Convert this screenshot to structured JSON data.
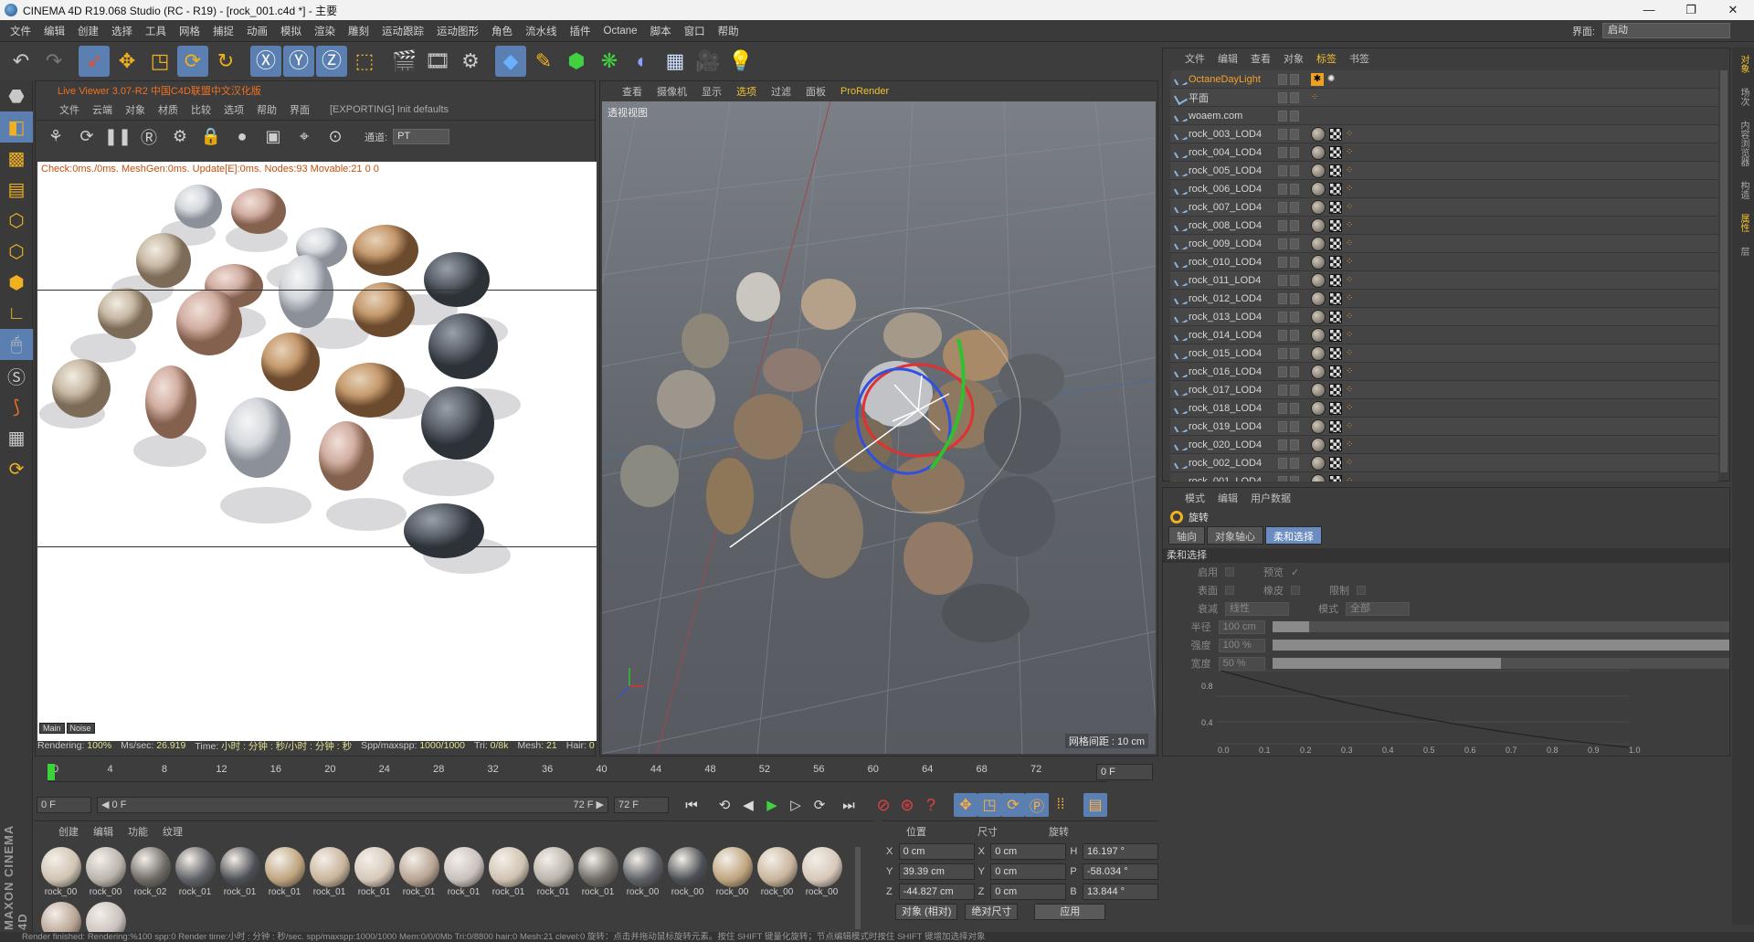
{
  "window": {
    "title": "CINEMA 4D R19.068 Studio (RC - R19) - [rock_001.c4d *] - 主要",
    "minimize": "—",
    "maximize": "❐",
    "close": "✕"
  },
  "menubar": {
    "items": [
      "文件",
      "编辑",
      "创建",
      "选择",
      "工具",
      "网格",
      "捕捉",
      "动画",
      "模拟",
      "渲染",
      "雕刻",
      "运动跟踪",
      "运动图形",
      "角色",
      "流水线",
      "插件",
      "Octane",
      "脚本",
      "窗口",
      "帮助"
    ],
    "layout_label": "界面:",
    "layout_value": "启动"
  },
  "toolbar": {
    "icons": [
      "undo-icon",
      "redo-icon",
      "select-icon",
      "move-icon",
      "scale-icon",
      "rotate-icon",
      "recent-icon",
      "x-axis-icon",
      "y-axis-icon",
      "z-axis-icon",
      "coord-system-icon",
      "render-view-icon",
      "render-picture-viewer-icon",
      "render-settings-icon",
      "cube-icon",
      "pen-icon",
      "subdivision-icon",
      "array-icon",
      "deformer-icon",
      "floor-icon",
      "camera-icon",
      "light-icon"
    ]
  },
  "live_viewer": {
    "title": "Live Viewer 3.07-R2 中国C4D联盟中文汉化版",
    "menu": [
      "文件",
      "云端",
      "对象",
      "材质",
      "比较",
      "选项",
      "帮助",
      "界面"
    ],
    "status": "[EXPORTING] Init defaults",
    "channel_label": "通道:",
    "channel_value": "PT",
    "info": "Check:0ms./0ms. MeshGen:0ms. Update[E]:0ms. Nodes:93 Movable:21  0 0",
    "tabs": [
      "Main",
      "Noise"
    ],
    "status_bar": {
      "rendering_label": "Rendering:",
      "rendering_value": "100%",
      "mssec_label": "Ms/sec:",
      "mssec_value": "26.919",
      "time_label": "Time:",
      "time_value": "小时 : 分钟 : 秒/小时 : 分钟 : 秒",
      "spp_label": "Spp/maxspp:",
      "spp_value": "1000/1000",
      "tri_label": "Tri:",
      "tri_value": "0/8k",
      "mesh_label": "Mesh:",
      "mesh_value": "21",
      "hair_label": "Hair:",
      "hair_value": "0"
    }
  },
  "viewport": {
    "menu": [
      "查看",
      "摄像机",
      "显示",
      "选项",
      "过滤",
      "面板",
      "ProRender"
    ],
    "label": "透视视图",
    "grid_label": "网格间距 : 10 cm"
  },
  "object_manager": {
    "menu": [
      "文件",
      "编辑",
      "查看",
      "对象",
      "标签",
      "书签"
    ],
    "objects": [
      {
        "name": "OctaneDayLight",
        "kind": "light"
      },
      {
        "name": "平面",
        "kind": "plane"
      },
      {
        "name": "woaem.com",
        "kind": "null"
      },
      {
        "name": "rock_003_LOD4",
        "kind": "rock"
      },
      {
        "name": "rock_004_LOD4",
        "kind": "rock"
      },
      {
        "name": "rock_005_LOD4",
        "kind": "rock"
      },
      {
        "name": "rock_006_LOD4",
        "kind": "rock"
      },
      {
        "name": "rock_007_LOD4",
        "kind": "rock"
      },
      {
        "name": "rock_008_LOD4",
        "kind": "rock"
      },
      {
        "name": "rock_009_LOD4",
        "kind": "rock"
      },
      {
        "name": "rock_010_LOD4",
        "kind": "rock"
      },
      {
        "name": "rock_011_LOD4",
        "kind": "rock"
      },
      {
        "name": "rock_012_LOD4",
        "kind": "rock"
      },
      {
        "name": "rock_013_LOD4",
        "kind": "rock"
      },
      {
        "name": "rock_014_LOD4",
        "kind": "rock"
      },
      {
        "name": "rock_015_LOD4",
        "kind": "rock"
      },
      {
        "name": "rock_016_LOD4",
        "kind": "rock"
      },
      {
        "name": "rock_017_LOD4",
        "kind": "rock"
      },
      {
        "name": "rock_018_LOD4",
        "kind": "rock"
      },
      {
        "name": "rock_019_LOD4",
        "kind": "rock"
      },
      {
        "name": "rock_020_LOD4",
        "kind": "rock"
      },
      {
        "name": "rock_002_LOD4",
        "kind": "rock"
      },
      {
        "name": "rock_001_LOD4",
        "kind": "rock"
      }
    ]
  },
  "attribute_manager": {
    "menu": [
      "模式",
      "编辑",
      "用户数据"
    ],
    "title": "旋转",
    "tabs": [
      "轴向",
      "对象轴心",
      "柔和选择"
    ],
    "section": "柔和选择",
    "enable_label": "启用",
    "preview_label": "预览",
    "surface_label": "表面",
    "rubber_label": "橡皮",
    "restrict_label": "限制",
    "falloff_label": "衰减",
    "falloff_value": "线性",
    "mode_label": "模式",
    "mode_value": "全部",
    "radius_label": "半径",
    "radius_value": "100 cm",
    "radius_fill": 0.08,
    "strength_label": "强度",
    "strength_value": "100 %",
    "strength_fill": 1.0,
    "width_label": "宽度",
    "width_value": "50 %",
    "width_fill": 0.5,
    "curve_y_ticks": [
      "0.8",
      "0.4"
    ],
    "curve_x_ticks": [
      "0.0",
      "0.1",
      "0.2",
      "0.3",
      "0.4",
      "0.5",
      "0.6",
      "0.7",
      "0.8",
      "0.9",
      "1.0"
    ]
  },
  "timeline": {
    "ticks": [
      "0",
      "4",
      "8",
      "12",
      "16",
      "20",
      "24",
      "28",
      "32",
      "36",
      "40",
      "44",
      "48",
      "52",
      "56",
      "60",
      "64",
      "68",
      "72"
    ],
    "end_field": "0 F",
    "current_frame": "0 F",
    "range_start": "◀ 0 F",
    "range_end": "72 F ▶",
    "max_frame": "72 F"
  },
  "material_manager": {
    "menu": [
      "创建",
      "编辑",
      "功能",
      "纹理"
    ],
    "materials": [
      "rock_00",
      "rock_00",
      "rock_02",
      "rock_01",
      "rock_01",
      "rock_01",
      "rock_01",
      "rock_01",
      "rock_01",
      "rock_01",
      "rock_01",
      "rock_01",
      "rock_01",
      "rock_00",
      "rock_00",
      "rock_00",
      "rock_00",
      "rock_00",
      "rock_00",
      "rock_00"
    ]
  },
  "coordinates": {
    "headers": [
      "位置",
      "尺寸",
      "旋转"
    ],
    "pos": {
      "x": "0 cm",
      "y": "39.39 cm",
      "z": "-44.827 cm"
    },
    "size": {
      "x": "0 cm",
      "y": "0 cm",
      "z": "0 cm"
    },
    "rot": {
      "h": "16.197 °",
      "p": "-58.034 °",
      "b": "13.844 °"
    },
    "axis_labels": {
      "x": "X",
      "y": "Y",
      "z": "Z",
      "h": "H",
      "p": "P",
      "b": "B"
    },
    "mode1": "对象 (相对)",
    "mode2": "绝对尺寸",
    "apply": "应用"
  },
  "statusbar": {
    "text": "Render finished: Rendering:%100 spp:0 Render time:小时 : 分钟 : 秒/sec. spp/maxspp:1000/1000 Mem:0/0/0Mb Tri:0/8800 hair:0 Mesh:21 clevel:0      旋转：点击并拖动鼠标旋转元素。按住 SHIFT 键量化旋转；节点编辑模式时按住 SHIFT 键增加选择对象"
  },
  "right_tabs": [
    "对象",
    "场次",
    "内容浏览器",
    "构造",
    "属性",
    "层"
  ],
  "colors": {
    "accent": "#f0c030",
    "selection": "#5a7fb0",
    "live_title": "#f07020"
  }
}
